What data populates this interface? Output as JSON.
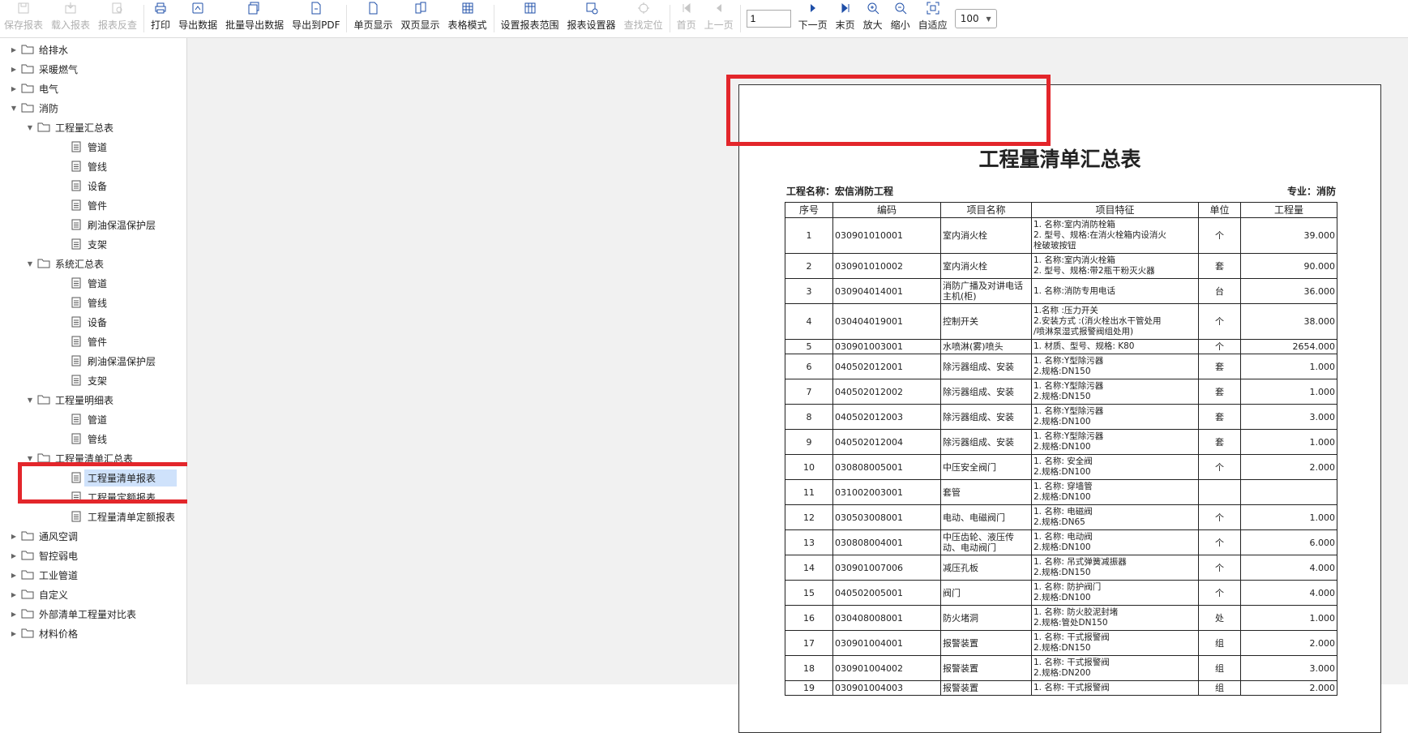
{
  "toolbar": {
    "buttons": [
      {
        "label": "保存报表",
        "icon": "save-report-icon",
        "disabled": true
      },
      {
        "label": "载入报表",
        "icon": "load-report-icon",
        "disabled": true
      },
      {
        "label": "报表反查",
        "icon": "report-lookup-icon",
        "disabled": true
      },
      {
        "label": "打印",
        "icon": "print-icon",
        "disabled": false
      },
      {
        "label": "导出数据",
        "icon": "export-data-icon",
        "disabled": false
      },
      {
        "label": "批量导出数据",
        "icon": "batch-export-icon",
        "disabled": false
      },
      {
        "label": "导出到PDF",
        "icon": "export-pdf-icon",
        "disabled": false
      },
      {
        "label": "单页显示",
        "icon": "single-page-icon",
        "disabled": false
      },
      {
        "label": "双页显示",
        "icon": "double-page-icon",
        "disabled": false
      },
      {
        "label": "表格模式",
        "icon": "table-mode-icon",
        "disabled": false
      },
      {
        "label": "设置报表范围",
        "icon": "report-range-icon",
        "disabled": false
      },
      {
        "label": "报表设置器",
        "icon": "report-settings-icon",
        "disabled": false
      },
      {
        "label": "查找定位",
        "icon": "find-locate-icon",
        "disabled": true
      },
      {
        "label": "首页",
        "icon": "first-page-icon",
        "disabled": true
      },
      {
        "label": "上一页",
        "icon": "prev-page-icon",
        "disabled": true
      },
      {
        "label": "下一页",
        "icon": "next-page-icon",
        "disabled": false
      },
      {
        "label": "末页",
        "icon": "last-page-icon",
        "disabled": false
      },
      {
        "label": "放大",
        "icon": "zoom-in-icon",
        "disabled": false
      },
      {
        "label": "缩小",
        "icon": "zoom-out-icon",
        "disabled": false
      },
      {
        "label": "自适应",
        "icon": "fit-icon",
        "disabled": false
      }
    ],
    "page_value": "1",
    "zoom_value": "100"
  },
  "tree": [
    {
      "label": "给排水",
      "type": "folder",
      "level": 0,
      "expanded": false
    },
    {
      "label": "采暖燃气",
      "type": "folder",
      "level": 0,
      "expanded": false
    },
    {
      "label": "电气",
      "type": "folder",
      "level": 0,
      "expanded": false
    },
    {
      "label": "消防",
      "type": "folder",
      "level": 0,
      "expanded": true
    },
    {
      "label": "工程量汇总表",
      "type": "folder",
      "level": 1,
      "expanded": true
    },
    {
      "label": "管道",
      "type": "doc",
      "level": 2
    },
    {
      "label": "管线",
      "type": "doc",
      "level": 2
    },
    {
      "label": "设备",
      "type": "doc",
      "level": 2
    },
    {
      "label": "管件",
      "type": "doc",
      "level": 2
    },
    {
      "label": "刷油保温保护层",
      "type": "doc",
      "level": 2
    },
    {
      "label": "支架",
      "type": "doc",
      "level": 2
    },
    {
      "label": "系统汇总表",
      "type": "folder",
      "level": 1,
      "expanded": true
    },
    {
      "label": "管道",
      "type": "doc",
      "level": 2
    },
    {
      "label": "管线",
      "type": "doc",
      "level": 2
    },
    {
      "label": "设备",
      "type": "doc",
      "level": 2
    },
    {
      "label": "管件",
      "type": "doc",
      "level": 2
    },
    {
      "label": "刷油保温保护层",
      "type": "doc",
      "level": 2
    },
    {
      "label": "支架",
      "type": "doc",
      "level": 2
    },
    {
      "label": "工程量明细表",
      "type": "folder",
      "level": 1,
      "expanded": true
    },
    {
      "label": "管道",
      "type": "doc",
      "level": 2
    },
    {
      "label": "管线",
      "type": "doc",
      "level": 2
    },
    {
      "label": "工程量清单汇总表",
      "type": "folder",
      "level": 1,
      "expanded": true
    },
    {
      "label": "工程量清单报表",
      "type": "doc",
      "level": 2,
      "selected": true
    },
    {
      "label": "工程量定额报表",
      "type": "doc",
      "level": 2
    },
    {
      "label": "工程量清单定额报表",
      "type": "doc",
      "level": 2
    },
    {
      "label": "通风空调",
      "type": "folder",
      "level": 0,
      "expanded": false
    },
    {
      "label": "智控弱电",
      "type": "folder",
      "level": 0,
      "expanded": false
    },
    {
      "label": "工业管道",
      "type": "folder",
      "level": 0,
      "expanded": false
    },
    {
      "label": "自定义",
      "type": "folder",
      "level": 0,
      "expanded": false
    },
    {
      "label": "外部清单工程量对比表",
      "type": "folder",
      "level": 0,
      "expanded": false
    },
    {
      "label": "材料价格",
      "type": "folder",
      "level": 0,
      "expanded": false
    }
  ],
  "report": {
    "title": "工程量清单汇总表",
    "project_name": "工程名称：宏信消防工程",
    "specialty": "专业：消防",
    "headers": [
      "序号",
      "编码",
      "项目名称",
      "项目特征",
      "单位",
      "工程量"
    ],
    "rows": [
      {
        "no": "1",
        "code": "030901010001",
        "name": "室内消火栓",
        "feature": [
          "1. 名称:室内消防栓箱",
          "2. 型号、规格:在消火栓箱内设消火",
          "栓破玻按钮"
        ],
        "unit": "个",
        "qty": "39.000"
      },
      {
        "no": "2",
        "code": "030901010002",
        "name": "室内消火栓",
        "feature": [
          "1. 名称:室内消火栓箱",
          "2. 型号、规格:带2瓶干粉灭火器"
        ],
        "unit": "套",
        "qty": "90.000"
      },
      {
        "no": "3",
        "code": "030904014001",
        "name": "消防广播及对讲电话主机(柜)",
        "feature": [
          "1. 名称:消防专用电话"
        ],
        "unit": "台",
        "qty": "36.000"
      },
      {
        "no": "4",
        "code": "030404019001",
        "name": "控制开关",
        "feature": [
          "1.名称 :压力开关",
          "2.安装方式 :(消火栓出水干管处用",
          "/喷淋泵湿式报警阀组处用)"
        ],
        "unit": "个",
        "qty": "38.000"
      },
      {
        "no": "5",
        "code": "030901003001",
        "name": "水喷淋(雾)喷头",
        "feature": [
          "1. 材质、型号、规格: K80"
        ],
        "unit": "个",
        "qty": "2654.000"
      },
      {
        "no": "6",
        "code": "040502012001",
        "name": "除污器组成、安装",
        "feature": [
          "1. 名称:Y型除污器",
          "2.规格:DN150"
        ],
        "unit": "套",
        "qty": "1.000"
      },
      {
        "no": "7",
        "code": "040502012002",
        "name": "除污器组成、安装",
        "feature": [
          "1. 名称:Y型除污器",
          "2.规格:DN150"
        ],
        "unit": "套",
        "qty": "1.000"
      },
      {
        "no": "8",
        "code": "040502012003",
        "name": "除污器组成、安装",
        "feature": [
          "1. 名称:Y型除污器",
          "2.规格:DN100"
        ],
        "unit": "套",
        "qty": "3.000"
      },
      {
        "no": "9",
        "code": "040502012004",
        "name": "除污器组成、安装",
        "feature": [
          "1. 名称:Y型除污器",
          "2.规格:DN100"
        ],
        "unit": "套",
        "qty": "1.000"
      },
      {
        "no": "10",
        "code": "030808005001",
        "name": "中压安全阀门",
        "feature": [
          "1. 名称: 安全阀",
          "2.规格:DN100"
        ],
        "unit": "个",
        "qty": "2.000"
      },
      {
        "no": "11",
        "code": "031002003001",
        "name": "套管",
        "feature": [
          "1. 名称: 穿墙管",
          "2.规格:DN100"
        ],
        "unit": "",
        "qty": ""
      },
      {
        "no": "12",
        "code": "030503008001",
        "name": "电动、电磁阀门",
        "feature": [
          "1. 名称: 电磁阀",
          "2.规格:DN65"
        ],
        "unit": "个",
        "qty": "1.000"
      },
      {
        "no": "13",
        "code": "030808004001",
        "name": "中压齿轮、液压传动、电动阀门",
        "feature": [
          "1. 名称: 电动阀",
          "2.规格:DN100"
        ],
        "unit": "个",
        "qty": "6.000"
      },
      {
        "no": "14",
        "code": "030901007006",
        "name": "减压孔板",
        "feature": [
          "1. 名称: 吊式弹簧减振器",
          "2.规格:DN150"
        ],
        "unit": "个",
        "qty": "4.000"
      },
      {
        "no": "15",
        "code": "040502005001",
        "name": "阀门",
        "feature": [
          "1. 名称: 防护阀门",
          "2.规格:DN100"
        ],
        "unit": "个",
        "qty": "4.000"
      },
      {
        "no": "16",
        "code": "030408008001",
        "name": "防火堵洞",
        "feature": [
          "1. 名称: 防火胶泥封堵",
          "2.规格:管处DN150"
        ],
        "unit": "处",
        "qty": "1.000"
      },
      {
        "no": "17",
        "code": "030901004001",
        "name": "报警装置",
        "feature": [
          "1. 名称: 干式报警阀",
          "2.规格:DN150"
        ],
        "unit": "组",
        "qty": "2.000"
      },
      {
        "no": "18",
        "code": "030901004002",
        "name": "报警装置",
        "feature": [
          "1. 名称: 干式报警阀",
          "2.规格:DN200"
        ],
        "unit": "组",
        "qty": "3.000"
      },
      {
        "no": "19",
        "code": "030901004003",
        "name": "报警装置",
        "feature": [
          "1. 名称: 干式报警阀"
        ],
        "unit": "组",
        "qty": "2.000"
      }
    ]
  }
}
